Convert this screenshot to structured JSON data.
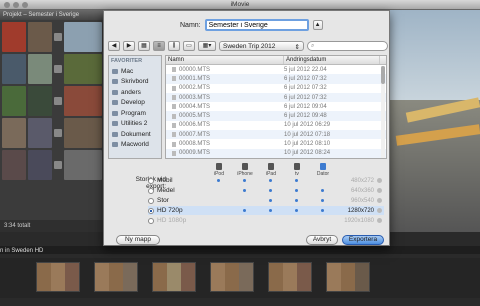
{
  "window": {
    "title": "iMovie"
  },
  "project": {
    "header": "Projekt – Semester i Sverige",
    "total": "3:34 totalt"
  },
  "event": {
    "title": "n in Sweden HD"
  },
  "dialog": {
    "name_label": "Namn:",
    "name_value": "Semester i Sverige",
    "folder_label": "Sweden Trip 2012",
    "sidebar_heading": "FAVORITER",
    "sidebar_items": [
      "Mac",
      "Skrivbord",
      "anders",
      "Develop",
      "Program",
      "Utilities 2",
      "Dokument",
      "Macworld"
    ],
    "columns": {
      "name": "Namn",
      "date": "Ändringsdatum"
    },
    "files": [
      {
        "name": "00000.MTS",
        "date": "5 jul 2012 22.04"
      },
      {
        "name": "00001.MTS",
        "date": "6 jul 2012 07:32"
      },
      {
        "name": "00002.MTS",
        "date": "6 jul 2012 07:32"
      },
      {
        "name": "00003.MTS",
        "date": "6 jul 2012 07:32"
      },
      {
        "name": "00004.MTS",
        "date": "6 jul 2012 09:04"
      },
      {
        "name": "00005.MTS",
        "date": "6 jul 2012 09:48"
      },
      {
        "name": "00006.MTS",
        "date": "10 jul 2012 06:29"
      },
      {
        "name": "00007.MTS",
        "date": "10 jul 2012 07:18"
      },
      {
        "name": "00008.MTS",
        "date": "10 jul 2012 08:10"
      },
      {
        "name": "00009.MTS",
        "date": "10 jul 2012 08:24"
      }
    ],
    "size_label": "Storlek vid export:",
    "devices": [
      "iPod",
      "iPhone",
      "iPad",
      "tv",
      "Dator"
    ],
    "options": [
      {
        "label": "Mobil",
        "res": "480x272",
        "selected": false,
        "enabled": true
      },
      {
        "label": "Medel",
        "res": "640x360",
        "selected": false,
        "enabled": true
      },
      {
        "label": "Stor",
        "res": "960x540",
        "selected": false,
        "enabled": true
      },
      {
        "label": "HD 720p",
        "res": "1280x720",
        "selected": true,
        "enabled": true
      },
      {
        "label": "HD 1080p",
        "res": "1920x1080",
        "selected": false,
        "enabled": false
      }
    ],
    "buttons": {
      "new_folder": "Ny mapp",
      "cancel": "Avbryt",
      "export": "Exportera"
    }
  },
  "colors": {
    "accent": "#4c8ee0",
    "selection": "#cfe0f5"
  }
}
